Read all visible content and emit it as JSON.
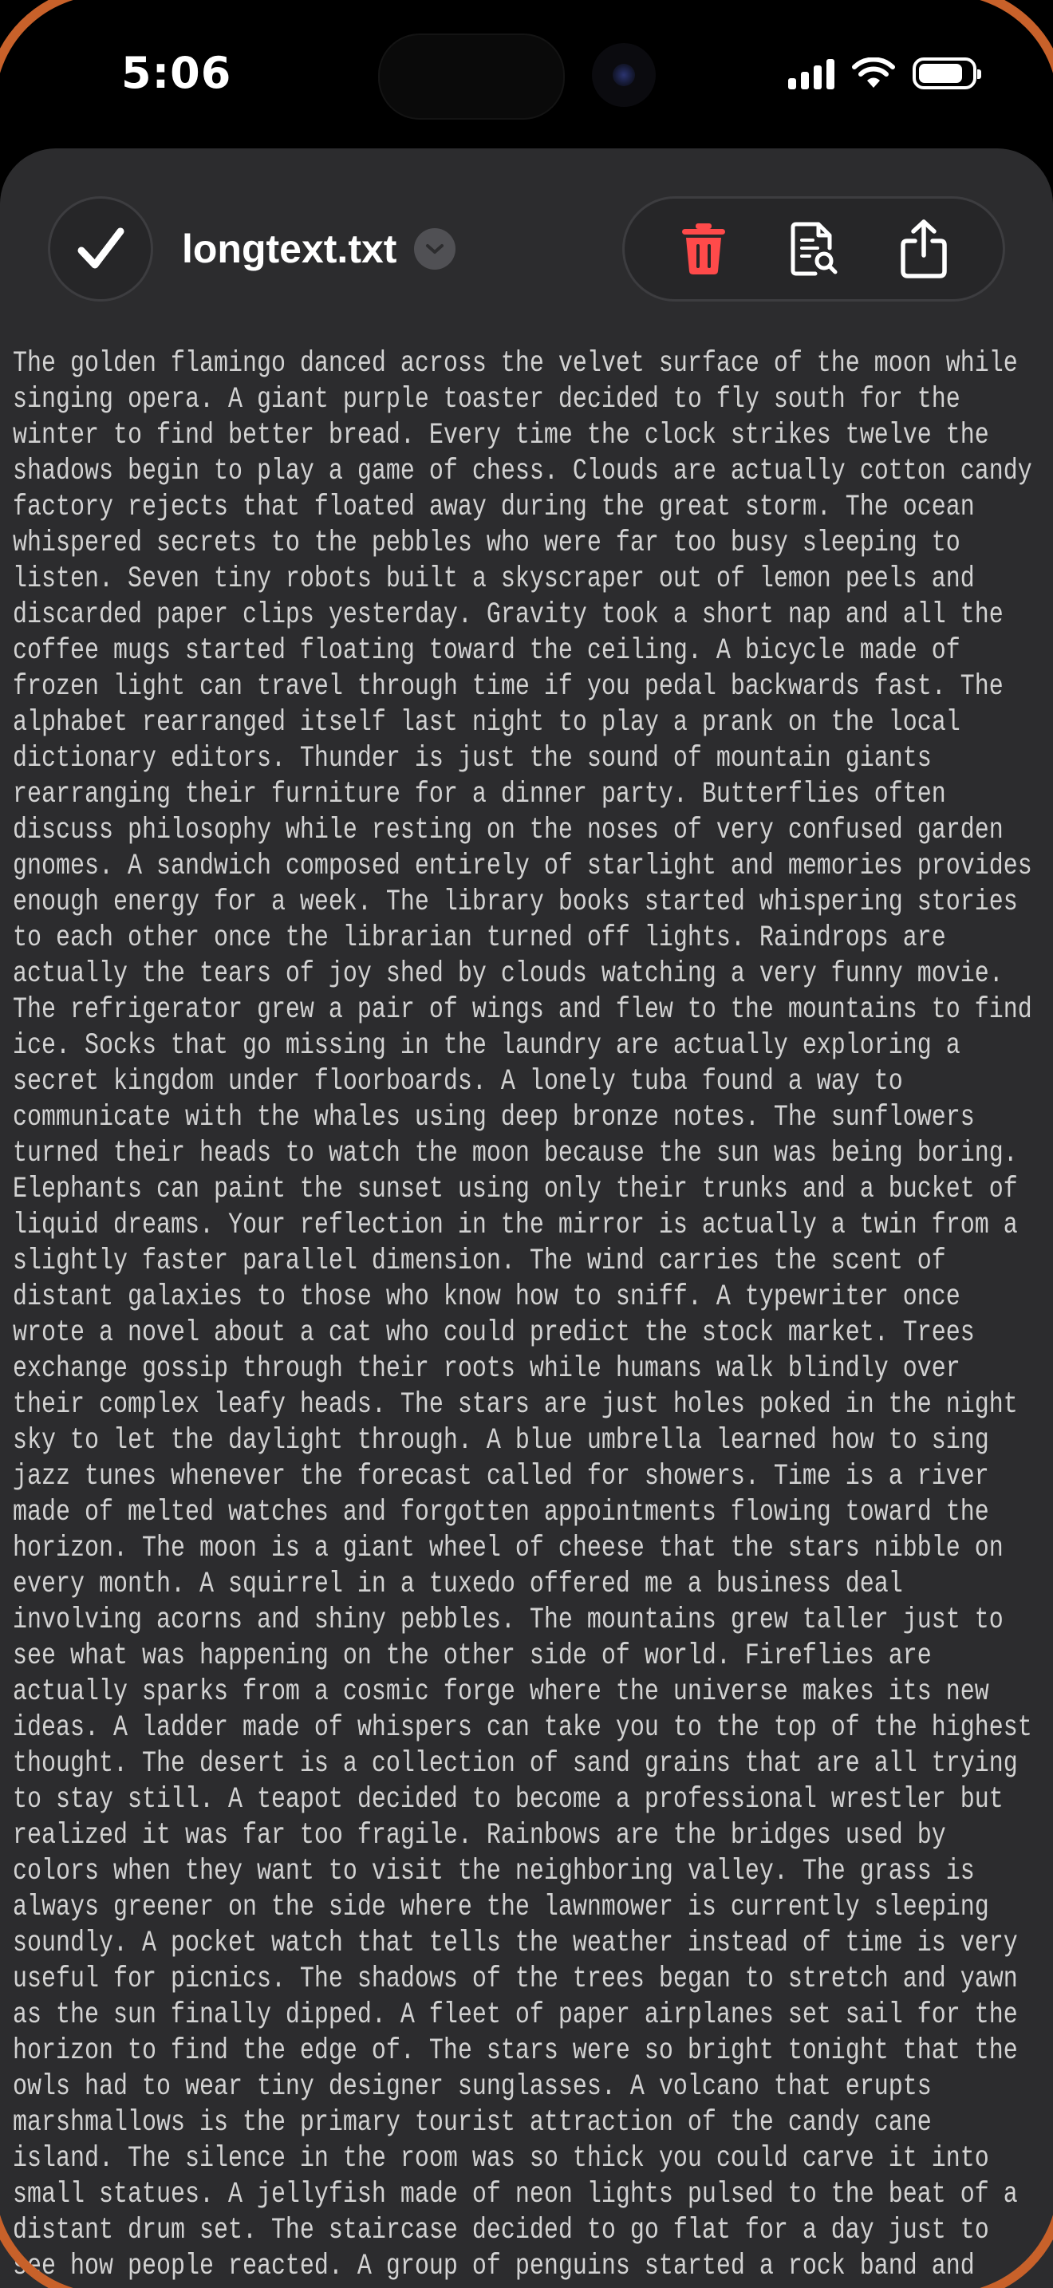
{
  "status_bar": {
    "time": "5:06",
    "battery_level": 0.85
  },
  "toolbar": {
    "done_icon": "checkmark-icon",
    "file_name": "longtext.txt",
    "title_menu_icon": "chevron-down-icon",
    "actions": [
      {
        "icon": "trash-icon",
        "color": "#ff4a4a"
      },
      {
        "icon": "document-search-icon",
        "color": "#ffffff"
      },
      {
        "icon": "share-icon",
        "color": "#ffffff"
      }
    ]
  },
  "document": {
    "content": "The golden flamingo danced across the velvet surface of the moon while\nsinging opera. A giant purple toaster decided to fly south for the\nwinter to find better bread. Every time the clock strikes twelve the\nshadows begin to play a game of chess. Clouds are actually cotton candy\nfactory rejects that floated away during the great storm. The ocean\nwhispered secrets to the pebbles who were far too busy sleeping to\nlisten. Seven tiny robots built a skyscraper out of lemon peels and\ndiscarded paper clips yesterday. Gravity took a short nap and all the\ncoffee mugs started floating toward the ceiling. A bicycle made of\nfrozen light can travel through time if you pedal backwards fast. The\nalphabet rearranged itself last night to play a prank on the local\ndictionary editors. Thunder is just the sound of mountain giants\nrearranging their furniture for a dinner party. Butterflies often\ndiscuss philosophy while resting on the noses of very confused garden\ngnomes. A sandwich composed entirely of starlight and memories provides\nenough energy for a week. The library books started whispering stories\nto each other once the librarian turned off lights. Raindrops are\nactually the tears of joy shed by clouds watching a very funny movie.\nThe refrigerator grew a pair of wings and flew to the mountains to find\nice. Socks that go missing in the laundry are actually exploring a\nsecret kingdom under floorboards. A lonely tuba found a way to\ncommunicate with the whales using deep bronze notes. The sunflowers\nturned their heads to watch the moon because the sun was being boring.\nElephants can paint the sunset using only their trunks and a bucket of\nliquid dreams. Your reflection in the mirror is actually a twin from a\nslightly faster parallel dimension. The wind carries the scent of\ndistant galaxies to those who know how to sniff. A typewriter once\nwrote a novel about a cat who could predict the stock market. Trees\nexchange gossip through their roots while humans walk blindly over\ntheir complex leafy heads. The stars are just holes poked in the night\nsky to let the daylight through. A blue umbrella learned how to sing\njazz tunes whenever the forecast called for showers. Time is a river\nmade of melted watches and forgotten appointments flowing toward the\nhorizon. The moon is a giant wheel of cheese that the stars nibble on\nevery month. A squirrel in a tuxedo offered me a business deal\ninvolving acorns and shiny pebbles. The mountains grew taller just to\nsee what was happening on the other side of world. Fireflies are\nactually sparks from a cosmic forge where the universe makes its new\nideas. A ladder made of whispers can take you to the top of the highest\nthought. The desert is a collection of sand grains that are all trying\nto stay still. A teapot decided to become a professional wrestler but\nrealized it was far too fragile. Rainbows are the bridges used by\ncolors when they want to visit the neighboring valley. The grass is\nalways greener on the side where the lawnmower is currently sleeping\nsoundly. A pocket watch that tells the weather instead of time is very\nuseful for picnics. The shadows of the trees began to stretch and yawn\nas the sun finally dipped. A fleet of paper airplanes set sail for the\nhorizon to find the edge of. The stars were so bright tonight that the\nowls had to wear tiny designer sunglasses. A volcano that erupts\nmarshmallows is the primary tourist attraction of the candy cane\nisland. The silence in the room was so thick you could carve it into\nsmall statues. A jellyfish made of neon lights pulsed to the beat of a\ndistant drum set. The staircase decided to go flat for a day just to\nsee how people reacted. A group of penguins started a rock band and"
  }
}
